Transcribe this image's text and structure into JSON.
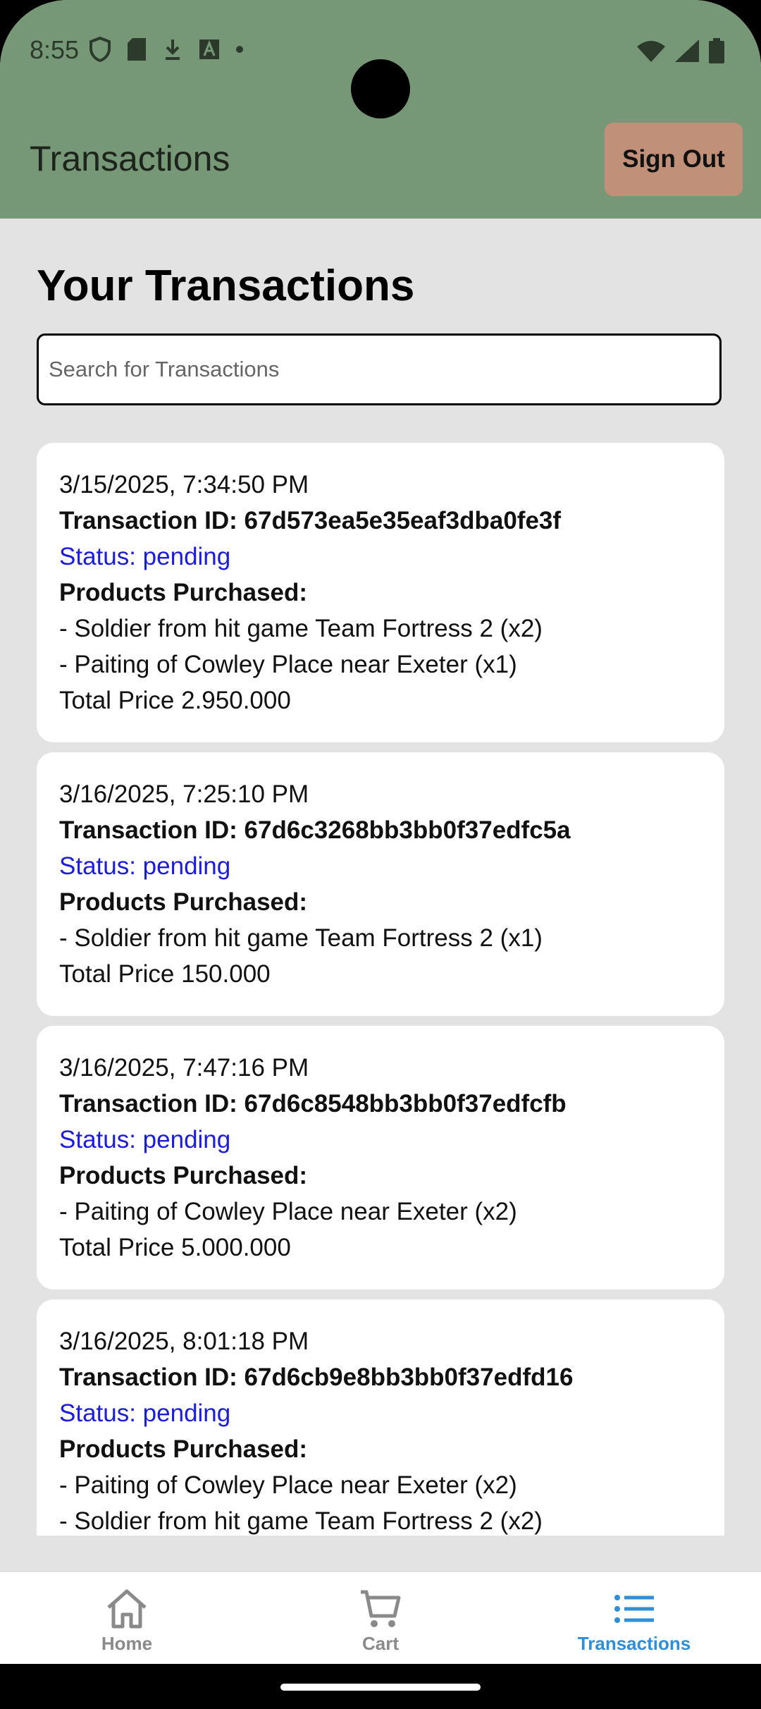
{
  "status_bar": {
    "time": "8:55"
  },
  "header": {
    "title": "Transactions",
    "sign_out_label": "Sign Out"
  },
  "main": {
    "heading": "Your Transactions",
    "search_placeholder": "Search for Transactions",
    "transactions": [
      {
        "date": "3/15/2025, 7:34:50 PM",
        "id_line": "Transaction ID: 67d573ea5e35eaf3dba0fe3f",
        "status_line": "Status: pending",
        "products_heading": "Products Purchased:",
        "products": [
          "- Soldier from hit game Team Fortress 2 (x2)",
          "- Paiting of Cowley Place near Exeter (x1)"
        ],
        "total_line": "Total Price 2.950.000"
      },
      {
        "date": "3/16/2025, 7:25:10 PM",
        "id_line": "Transaction ID: 67d6c3268bb3bb0f37edfc5a",
        "status_line": "Status: pending",
        "products_heading": "Products Purchased:",
        "products": [
          "- Soldier from hit game Team Fortress 2 (x1)"
        ],
        "total_line": "Total Price 150.000"
      },
      {
        "date": "3/16/2025, 7:47:16 PM",
        "id_line": "Transaction ID: 67d6c8548bb3bb0f37edfcfb",
        "status_line": "Status: pending",
        "products_heading": "Products Purchased:",
        "products": [
          "- Paiting of Cowley Place near Exeter (x2)"
        ],
        "total_line": "Total Price 5.000.000"
      },
      {
        "date": "3/16/2025, 8:01:18 PM",
        "id_line": "Transaction ID: 67d6cb9e8bb3bb0f37edfd16",
        "status_line": "Status: pending",
        "products_heading": "Products Purchased:",
        "products": [
          "- Paiting of Cowley Place near Exeter (x2)",
          "- Soldier from hit game Team Fortress 2 (x2)"
        ]
      }
    ]
  },
  "nav": {
    "items": [
      {
        "label": "Home",
        "icon": "home-icon"
      },
      {
        "label": "Cart",
        "icon": "cart-icon"
      },
      {
        "label": "Transactions",
        "icon": "list-icon"
      }
    ],
    "active_color": "#2f8ed6",
    "inactive_color": "#8a8a8a"
  },
  "colors": {
    "header": "#779876",
    "sign_out": "#c19079",
    "status": "#1c1cdc",
    "background": "#e3e3e3"
  }
}
